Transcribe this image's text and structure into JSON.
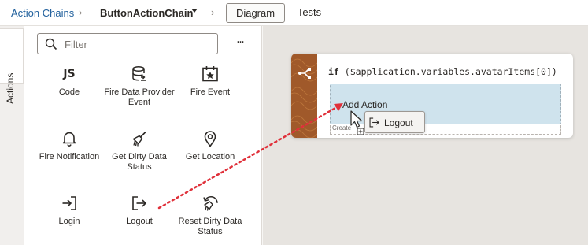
{
  "header": {
    "breadcrumb_root": "Action Chains",
    "breadcrumb_current": "ButtonActionChain",
    "tabs": [
      {
        "label": "Diagram",
        "active": true
      },
      {
        "label": "Tests",
        "active": false
      }
    ]
  },
  "side_tab": {
    "label": "Actions"
  },
  "palette": {
    "filter_placeholder": "Filter",
    "more_label": "•••",
    "items": [
      {
        "label": "Code",
        "icon": "js-icon",
        "icon_text": "JS"
      },
      {
        "label": "Fire Data Provider Event",
        "icon": "database-icon"
      },
      {
        "label": "Fire Event",
        "icon": "calendar-star-icon"
      },
      {
        "label": "Fire Notification",
        "icon": "bell-icon"
      },
      {
        "label": "Get Dirty Data Status",
        "icon": "broom-icon"
      },
      {
        "label": "Get Location",
        "icon": "map-pin-icon"
      },
      {
        "label": "Login",
        "icon": "login-icon"
      },
      {
        "label": "Logout",
        "icon": "logout-icon"
      },
      {
        "label": "Reset Dirty Data Status",
        "icon": "reset-broom-icon"
      }
    ]
  },
  "canvas": {
    "condition_keyword": "if",
    "condition_expr": "($application.variables.avatarItems[0])",
    "drop_label": "Add Action",
    "below_label": "Create",
    "drag_chip_label": "Logout"
  },
  "colors": {
    "accent_link": "#1f5f9c",
    "node_bar": "#a0592a",
    "drop_zone": "#cfe3ed",
    "drag_line": "#e0303a"
  }
}
